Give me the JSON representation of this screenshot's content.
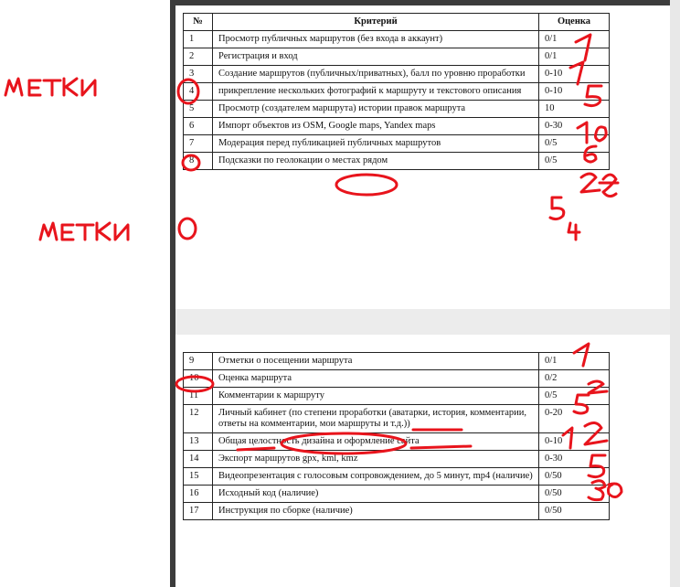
{
  "table": {
    "headers": {
      "num": "№",
      "criterion": "Критерий",
      "score": "Оценка"
    },
    "rows_page1": [
      {
        "num": "1",
        "criterion": "Просмотр публичных маршрутов (без входа в аккаунт)",
        "score": "0/1"
      },
      {
        "num": "2",
        "criterion": "Регистрация и вход",
        "score": "0/1"
      },
      {
        "num": "3",
        "criterion": "Создание маршрутов (публичных/приватных), балл по уровню проработки",
        "score": "0-10"
      },
      {
        "num": "4",
        "criterion": "прикрепление нескольких фотографий к маршруту и текстового описания",
        "score": "0-10"
      },
      {
        "num": "5",
        "criterion": "Просмотр (создателем маршрута) истории правок маршрута",
        "score": "10"
      },
      {
        "num": "6",
        "criterion": "Импорт объектов из OSM, Google maps, Yandex maps",
        "score": "0-30"
      },
      {
        "num": "7",
        "criterion": "Модерация перед публикацией публичных маршрутов",
        "score": "0/5"
      },
      {
        "num": "8",
        "criterion": "Подсказки по геолокации о местах рядом",
        "score": "0/5"
      }
    ],
    "rows_page2": [
      {
        "num": "9",
        "criterion": "Отметки о посещении маршрута",
        "score": "0/1"
      },
      {
        "num": "10",
        "criterion": "Оценка маршрута",
        "score": "0/2"
      },
      {
        "num": "11",
        "criterion": "Комментарии к маршруту",
        "score": "0/5"
      },
      {
        "num": "12",
        "criterion": "Личный кабинет (по степени проработки (аватарки, история, комментарии, ответы на комментарии, мои маршруты и т.д.))",
        "score": "0-20"
      },
      {
        "num": "13",
        "criterion": "Общая целостность дизайна и оформление сайта",
        "score": "0-10"
      },
      {
        "num": "14",
        "criterion": "Экспорт маршрутов gpx, kml, kmz",
        "score": "0-30"
      },
      {
        "num": "15",
        "criterion": "Видеопрезентация с голосовым сопровождением, до 5 минут, mp4 (наличие)",
        "score": "0/50"
      },
      {
        "num": "16",
        "criterion": "Исходный код (наличие)",
        "score": "0/50"
      },
      {
        "num": "17",
        "criterion": "Инструкция по сборке (наличие)",
        "score": "0/50"
      }
    ]
  },
  "handwriting": {
    "label_1": "МЕТКИ",
    "label_2": "МЕТКИ",
    "scores": [
      "1",
      "1",
      "5",
      "10",
      "6",
      "28",
      "5",
      "4",
      "1",
      "2",
      "5",
      "12",
      "5",
      "30"
    ],
    "ink_color": "#e8141c"
  }
}
